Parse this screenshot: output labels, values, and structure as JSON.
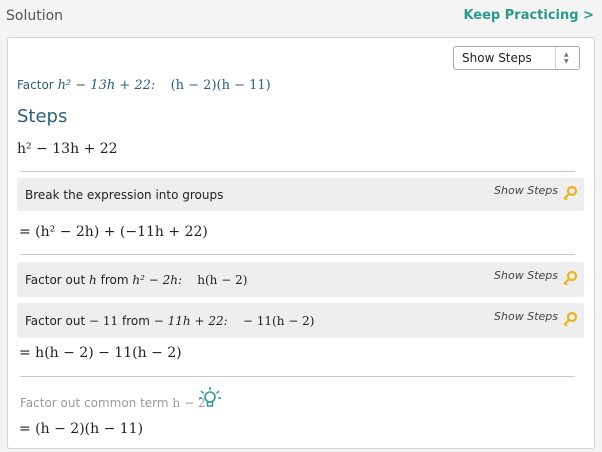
{
  "header": {
    "title": "Solution",
    "keep_practicing": "Keep Practicing >"
  },
  "select": {
    "selected": "Show Steps",
    "icon": "up-down-chevron-icon"
  },
  "factor": {
    "label": "Factor",
    "expression": "h² − 13h + 22:",
    "result": "(h − 2)(h − 11)"
  },
  "steps": {
    "heading": "Steps",
    "start": "h² − 13h + 22",
    "items": [
      {
        "label": "Break the expression into groups",
        "show_steps": "Show Steps",
        "result": "= (h² − 2h) + (−11h + 22)"
      },
      {
        "label_prefix": "Factor out",
        "label_var": "h",
        "label_mid": "from",
        "label_expr": "h² − 2h:",
        "label_result": "h(h − 2)",
        "show_steps": "Show Steps"
      },
      {
        "label_prefix": "Factor out",
        "label_var": "− 11",
        "label_mid": "from",
        "label_expr": "− 11h + 22:",
        "label_result": "− 11(h − 2)",
        "show_steps": "Show Steps",
        "result": "= h(h − 2) − 11(h − 2)"
      }
    ],
    "common_label": "Factor out common term",
    "common_term": "h − 2",
    "final": "= (h − 2)(h − 11)"
  },
  "colors": {
    "accent": "#2b9a86",
    "heading": "#2c5f78",
    "key_icon": "#e8b325",
    "bulb_icon": "#2b9a86"
  }
}
